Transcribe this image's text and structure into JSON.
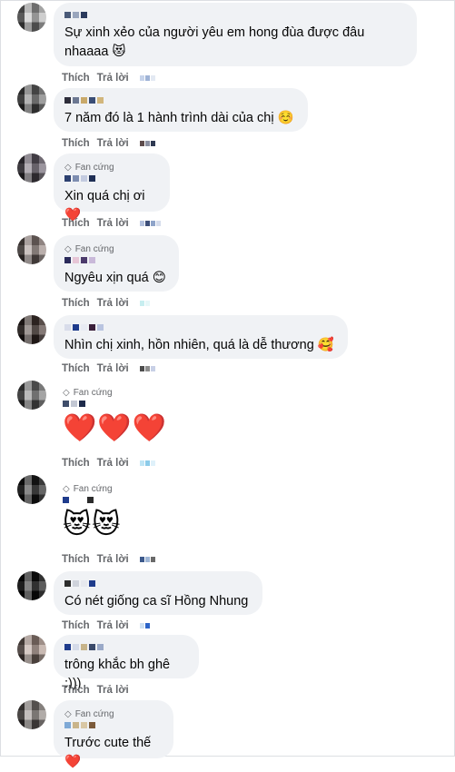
{
  "actions": {
    "like": "Thích",
    "reply": "Trả lời"
  },
  "badge_label": "Fan cứng",
  "comments": [
    {
      "text": "Sự xinh xẻo của người yêu em hong đùa được đâu\nnhaaaa 😻",
      "badge": false,
      "emoji_only": false
    },
    {
      "text": "7 năm đó là 1 hành trình dài của chị ☺️",
      "badge": false,
      "emoji_only": false
    },
    {
      "text": "Xin quá chị ơi❤️",
      "badge": true,
      "emoji_only": false
    },
    {
      "text": "Ngyêu xịn quá 😊",
      "badge": true,
      "emoji_only": false
    },
    {
      "text": "Nhìn chị xinh, hồn nhiên, quá là dễ thương 🥰",
      "badge": false,
      "emoji_only": false
    },
    {
      "text": "❤️❤️❤️",
      "badge": true,
      "emoji_only": true
    },
    {
      "text": "😻😻",
      "badge": true,
      "emoji_only": true
    },
    {
      "text": "Có nét giống ca sĩ Hồng Nhung",
      "badge": false,
      "emoji_only": false
    },
    {
      "text": "trông khắc bh ghê :)))",
      "badge": false,
      "emoji_only": false
    },
    {
      "text": "Trước cute thế❤️",
      "badge": true,
      "emoji_only": false
    }
  ],
  "colors": {
    "bubble": "#f0f2f5",
    "meta": "#65676b",
    "text": "#050505",
    "heart": "#e41e3f"
  },
  "icons": {
    "badge": "diamond-icon"
  }
}
